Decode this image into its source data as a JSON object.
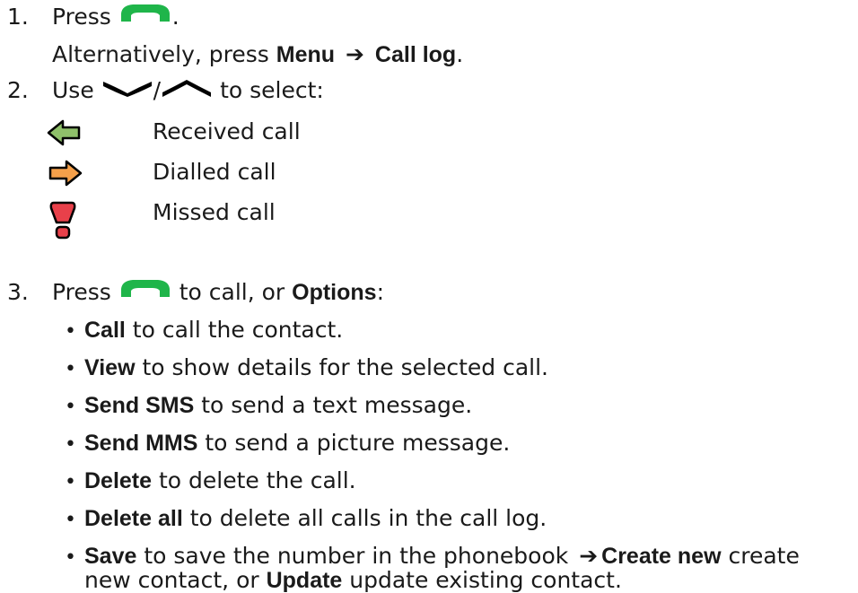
{
  "step1": {
    "number": "1.",
    "press": "Press",
    "period": ".",
    "alt_prefix": "Alternatively, press",
    "menu": "Menu",
    "call_log": "Call log",
    "alt_end": "."
  },
  "step2": {
    "number": "2.",
    "use": "Use",
    "slash": "/",
    "to_select": "to select:",
    "legend": [
      {
        "icon": "received-call-icon",
        "label": "Received call",
        "color": "#8fc06a"
      },
      {
        "icon": "dialled-call-icon",
        "label": "Dialled call",
        "color": "#f5a04a"
      },
      {
        "icon": "missed-call-icon",
        "label": "Missed call",
        "color": "#e8404a"
      }
    ]
  },
  "step3": {
    "number": "3.",
    "press": "Press",
    "to_call": "to call, or",
    "options": "Options",
    "colon": ":",
    "items": [
      {
        "bold": "Call",
        "text": " to call the contact."
      },
      {
        "bold": "View",
        "text": " to show details for the selected call."
      },
      {
        "bold": "Send SMS",
        "text": " to send a text message."
      },
      {
        "bold": "Send MMS",
        "text": " to send a picture message."
      },
      {
        "bold": "Delete",
        "text": " to delete the call."
      },
      {
        "bold": "Delete all",
        "text": " to delete all calls in the call log."
      }
    ],
    "save": {
      "bold": "Save",
      "text1": " to save the number in the phonebook ",
      "bold2": "Create new",
      "text2": " create",
      "line2_text1": "new contact, or ",
      "bold3": "Update",
      "line2_text2": " update existing contact."
    }
  },
  "colors": {
    "call_key": "#1fb54a",
    "text": "#1a1a1a"
  }
}
